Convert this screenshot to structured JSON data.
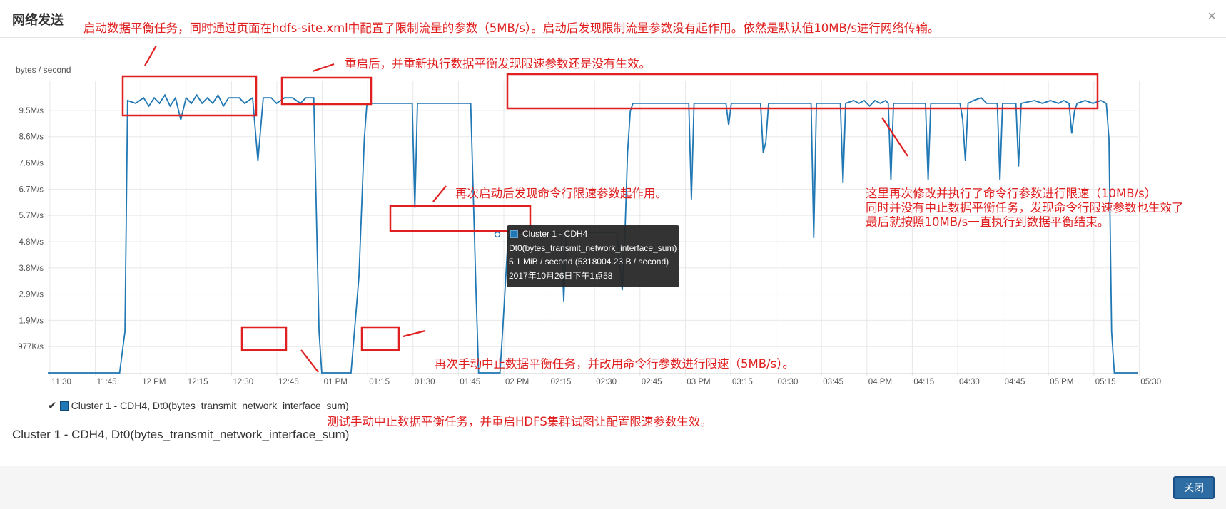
{
  "dialog": {
    "title": "网络发送",
    "close_icon": "close-icon",
    "close_button": "关闭"
  },
  "chart_data": {
    "type": "line",
    "ylabel": "bytes / second",
    "y_ticks": [
      "977K/s",
      "1.9M/s",
      "2.9M/s",
      "3.8M/s",
      "4.8M/s",
      "5.7M/s",
      "6.7M/s",
      "7.6M/s",
      "8.6M/s",
      "9.5M/s"
    ],
    "y_max_mb": 10.6,
    "x_ticks": [
      "11:30",
      "11:45",
      "12 PM",
      "12:15",
      "12:30",
      "12:45",
      "01 PM",
      "01:15",
      "01:30",
      "01:45",
      "02 PM",
      "02:15",
      "02:30",
      "02:45",
      "03 PM",
      "03:15",
      "03:30",
      "03:45",
      "04 PM",
      "04:15",
      "04:30",
      "04:45",
      "05 PM",
      "05:15",
      "05:30"
    ],
    "x_start_minutes": 0,
    "x_end_minutes": 360,
    "series": [
      {
        "name": "Cluster 1 - CDH4, Dt0(bytes_transmit_network_interface_sum)",
        "color": "#1f77b4",
        "points": [
          [
            0,
            0
          ],
          [
            27,
            0
          ],
          [
            29,
            1.5
          ],
          [
            30,
            9.9
          ],
          [
            33,
            9.8
          ],
          [
            36,
            10.0
          ],
          [
            38,
            9.7
          ],
          [
            40,
            10.0
          ],
          [
            42,
            9.8
          ],
          [
            44,
            10.1
          ],
          [
            46,
            9.7
          ],
          [
            48,
            10.0
          ],
          [
            50,
            9.2
          ],
          [
            52,
            10.0
          ],
          [
            54,
            9.8
          ],
          [
            56,
            10.1
          ],
          [
            58,
            9.8
          ],
          [
            60,
            10.0
          ],
          [
            62,
            9.8
          ],
          [
            64,
            10.1
          ],
          [
            66,
            9.7
          ],
          [
            68,
            10.0
          ],
          [
            72,
            10.0
          ],
          [
            74,
            9.8
          ],
          [
            77,
            10.0
          ],
          [
            79,
            7.7
          ],
          [
            81,
            10.0
          ],
          [
            84,
            10.0
          ],
          [
            86,
            9.8
          ],
          [
            89,
            10.0
          ],
          [
            92,
            10.0
          ],
          [
            95,
            9.8
          ],
          [
            97,
            10.0
          ],
          [
            100,
            10.0
          ],
          [
            102,
            1.5
          ],
          [
            103,
            0
          ],
          [
            114,
            0
          ],
          [
            117,
            3.5
          ],
          [
            119,
            8.5
          ],
          [
            120,
            9.8
          ],
          [
            137,
            9.8
          ],
          [
            138,
            6.0
          ],
          [
            139,
            9.8
          ],
          [
            159,
            9.8
          ],
          [
            161,
            3.0
          ],
          [
            162,
            0
          ],
          [
            170,
            0
          ],
          [
            171,
            1.5
          ],
          [
            173,
            4.8
          ],
          [
            174,
            5.1
          ],
          [
            193,
            5.1
          ],
          [
            194,
            2.6
          ],
          [
            195,
            5.1
          ],
          [
            214,
            5.1
          ],
          [
            216,
            3.0
          ],
          [
            217,
            5.0
          ],
          [
            218,
            8.0
          ],
          [
            219,
            9.5
          ],
          [
            220,
            9.8
          ],
          [
            241,
            9.8
          ],
          [
            242,
            6.3
          ],
          [
            243,
            9.8
          ],
          [
            255,
            9.8
          ],
          [
            256,
            9.0
          ],
          [
            257,
            9.8
          ],
          [
            268,
            9.8
          ],
          [
            269,
            8.0
          ],
          [
            270,
            8.4
          ],
          [
            271,
            9.8
          ],
          [
            287,
            9.8
          ],
          [
            288,
            4.9
          ],
          [
            289,
            9.8
          ],
          [
            298,
            9.8
          ],
          [
            299,
            6.9
          ],
          [
            300,
            9.8
          ],
          [
            303,
            9.9
          ],
          [
            305,
            9.8
          ],
          [
            307,
            9.9
          ],
          [
            309,
            9.7
          ],
          [
            311,
            9.9
          ],
          [
            313,
            9.8
          ],
          [
            315,
            9.9
          ],
          [
            316,
            9.8
          ],
          [
            317,
            7.0
          ],
          [
            318,
            9.8
          ],
          [
            330,
            9.8
          ],
          [
            331,
            7.0
          ],
          [
            332,
            9.8
          ],
          [
            343,
            9.8
          ],
          [
            344,
            9.2
          ],
          [
            345,
            7.7
          ],
          [
            346,
            9.8
          ],
          [
            348,
            9.9
          ],
          [
            351,
            10.0
          ],
          [
            353,
            9.8
          ],
          [
            357,
            9.8
          ],
          [
            358,
            7.0
          ],
          [
            359,
            9.8
          ],
          [
            364,
            9.8
          ],
          [
            365,
            7.5
          ],
          [
            366,
            9.8
          ],
          [
            371,
            9.9
          ],
          [
            374,
            9.8
          ],
          [
            377,
            9.9
          ],
          [
            380,
            9.8
          ],
          [
            382,
            9.9
          ],
          [
            384,
            9.8
          ],
          [
            385,
            8.7
          ],
          [
            386,
            9.5
          ],
          [
            387,
            9.8
          ],
          [
            390,
            9.9
          ],
          [
            393,
            9.8
          ],
          [
            396,
            9.9
          ],
          [
            398,
            9.8
          ],
          [
            399,
            8.5
          ],
          [
            400,
            1.5
          ],
          [
            401,
            0
          ],
          [
            410,
            0
          ]
        ]
      }
    ],
    "x_axis_max_value": 410
  },
  "tooltip": {
    "series_name": "Cluster 1 - CDH4",
    "metric": "Dt0(bytes_transmit_network_interface_sum)",
    "value": "5.1 MiB / second (5318004.23 B / second)",
    "time": "2017年10月26日下午1点58"
  },
  "legend": {
    "check": "✔",
    "label": "Cluster 1 - CDH4, Dt0(bytes_transmit_network_interface_sum)"
  },
  "caption": "Cluster 1 - CDH4, Dt0(bytes_transmit_network_interface_sum)",
  "annotations": {
    "a1": "启动数据平衡任务，同时通过页面在hdfs-site.xml中配置了限制流量的参数（5MB/s）。启动后发现限制流量参数没有起作用。依然是默认值10MB/s进行网络传输。",
    "a2": "重启后，并重新执行数据平衡发现限速参数还是没有生效。",
    "a3": "再次启动后发现命令行限速参数起作用。",
    "a4_line1": "这里再次修改并执行了命令行参数进行限速（10MB/s）",
    "a4_line2": "同时并没有中止数据平衡任务，发现命令行限速参数也生效了",
    "a4_line3": "最后就按照10MB/s一直执行到数据平衡结束。",
    "a5": "再次手动中止数据平衡任务，并改用命令行参数进行限速（5MB/s）。",
    "a6": "测试手动中止数据平衡任务，并重启HDFS集群试图让配置限速参数生效。"
  }
}
